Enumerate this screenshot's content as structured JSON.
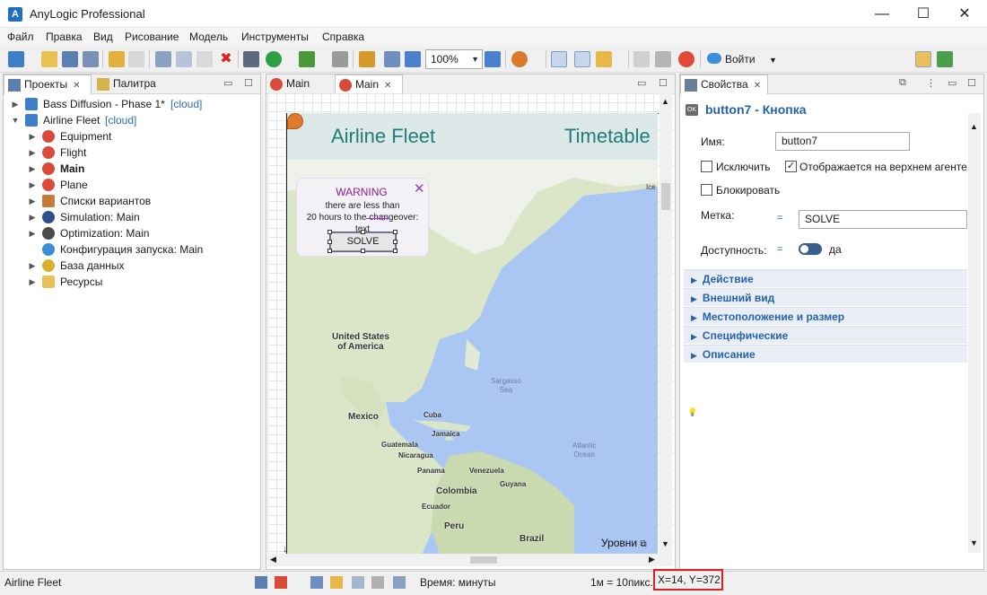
{
  "window": {
    "title": "AnyLogic Professional",
    "controls": [
      "—",
      "☐",
      "✕"
    ]
  },
  "menu": [
    "Файл",
    "Правка",
    "Вид",
    "Рисование",
    "Модель",
    "Инструменты",
    "Справка"
  ],
  "toolbar": {
    "zoom": "100%",
    "login_label": "Войти"
  },
  "left_panel": {
    "tabs": [
      "Проекты",
      "Палитра"
    ],
    "tree": [
      {
        "label": "Bass Diffusion - Phase 1*",
        "tag": "[cloud]",
        "level": 0,
        "expanded": false,
        "icon": "model-icon"
      },
      {
        "label": "Airline Fleet",
        "tag": "[cloud]",
        "level": 0,
        "expanded": true,
        "icon": "model-icon"
      },
      {
        "label": "Equipment",
        "level": 1,
        "icon": "agent-icon"
      },
      {
        "label": "Flight",
        "level": 1,
        "icon": "agent-icon"
      },
      {
        "label": "Main",
        "level": 1,
        "icon": "agent-icon",
        "bold": true
      },
      {
        "label": "Plane",
        "level": 1,
        "icon": "agent-icon"
      },
      {
        "label": "Списки вариантов",
        "level": 1,
        "icon": "table-icon"
      },
      {
        "label": "Simulation: Main",
        "level": 1,
        "icon": "simulation-icon"
      },
      {
        "label": "Optimization: Main",
        "level": 1,
        "icon": "optimization-icon"
      },
      {
        "label": "Конфигурация запуска: Main",
        "level": 1,
        "icon": "cloud-icon",
        "no_caret": true
      },
      {
        "label": "База данных",
        "level": 1,
        "icon": "database-icon"
      },
      {
        "label": "Ресурсы",
        "level": 1,
        "icon": "folder-icon"
      }
    ]
  },
  "editor": {
    "tabs": [
      "Main",
      "Main"
    ],
    "banner_title": "Airline Fleet",
    "banner_right": "Timetable",
    "warning": {
      "title": "WARNING",
      "line1": "there are less than",
      "line2": "20 hours to the changeover:",
      "line3": "text",
      "button": "SOLVE"
    },
    "map_labels": {
      "usa": "United States\nof America",
      "usa_line1": "United States",
      "usa_line2": "of America",
      "mexico": "Mexico",
      "cuba": "Cuba",
      "jamaica": "Jamaica",
      "guatemala": "Guatemala",
      "nicaragua": "Nicaragua",
      "panama": "Panama",
      "venezuela": "Venezuela",
      "guyana": "Guyana",
      "colombia": "Colombia",
      "ecuador": "Ecuador",
      "peru": "Peru",
      "brazil": "Brazil",
      "sargasso1": "Sargasso",
      "sargasso2": "Sea",
      "atlantic1": "Atlantic",
      "atlantic2": "Ocean",
      "ice": "Ice"
    },
    "levels": "Уровни"
  },
  "properties": {
    "tab": "Свойства",
    "header": "button7 - Кнопка",
    "name_label": "Имя:",
    "name_value": "button7",
    "exclude_label": "Исключить",
    "exclude_checked": false,
    "shown_label": "Отображается на верхнем агенте",
    "shown_checked": true,
    "lock_label": "Блокировать",
    "lock_checked": false,
    "caption_label": "Метка:",
    "caption_value": "SOLVE",
    "enabled_label": "Доступность:",
    "enabled_value": "да",
    "sections": [
      "Действие",
      "Внешний вид",
      "Местоположение и размер",
      "Специфические",
      "Описание"
    ]
  },
  "status": {
    "left": "Airline Fleet",
    "time": "Время: минуты",
    "scale": "1м = 10пикс.",
    "coords": "X=14, Y=372"
  }
}
